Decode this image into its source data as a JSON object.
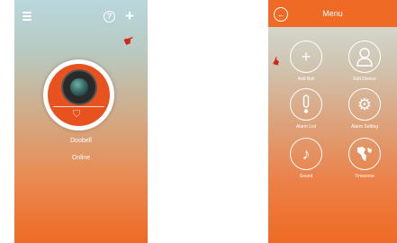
{
  "left_screen": {
    "device": {
      "name": "Doobell",
      "status": "Online"
    },
    "icons": [
      "menu-icon",
      "help-icon",
      "add-icon",
      "hand-pointer-icon",
      "camera-icon",
      "shield-icon"
    ],
    "accent": "#ee6a25"
  },
  "right_screen": {
    "header": {
      "title": "Menu"
    },
    "items": [
      {
        "label": "Add Bell",
        "icon": "add-icon"
      },
      {
        "label": "Edit Device",
        "icon": "user-icon"
      },
      {
        "label": "Alarm List",
        "icon": "alarm-icon"
      },
      {
        "label": "Alarm Setting",
        "icon": "gear-icon"
      },
      {
        "label": "Sound",
        "icon": "music-note-icon"
      },
      {
        "label": "Timezone",
        "icon": "globe-icon"
      }
    ]
  }
}
